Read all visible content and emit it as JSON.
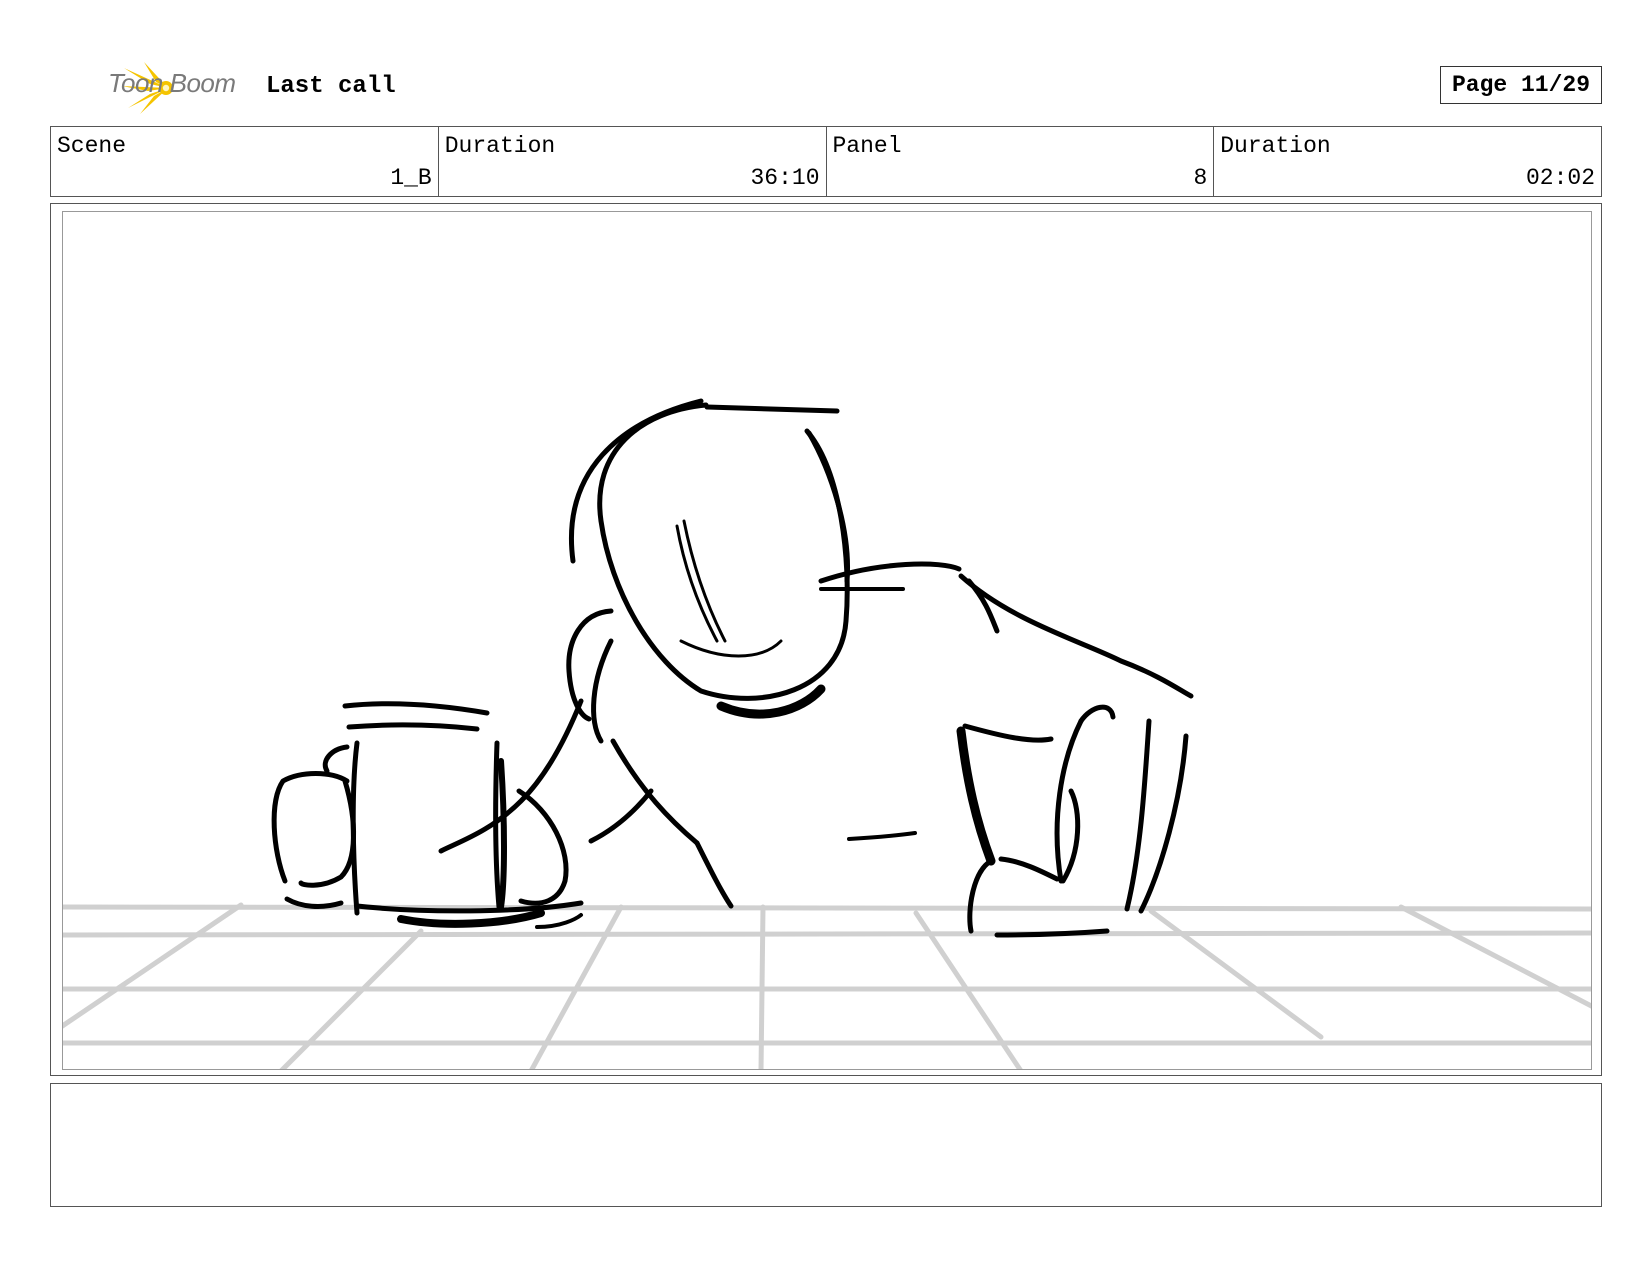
{
  "header": {
    "logo_text": "Toon Boom",
    "title": "Last call",
    "page": "Page 11/29"
  },
  "info": {
    "scene_label": "Scene",
    "scene_value": "1_B",
    "scene_duration_label": "Duration",
    "scene_duration_value": "36:10",
    "panel_label": "Panel",
    "panel_value": "8",
    "panel_duration_label": "Duration",
    "panel_duration_value": "02:02"
  },
  "panel": {
    "image_icon": "sketch-figure-bar-mug"
  },
  "notes": {
    "text": ""
  },
  "colors": {
    "logo_star": "#f5c400",
    "logo_text": "#7a7a7a",
    "sketch": "#000000",
    "floor_grid": "#d0d0d0"
  }
}
